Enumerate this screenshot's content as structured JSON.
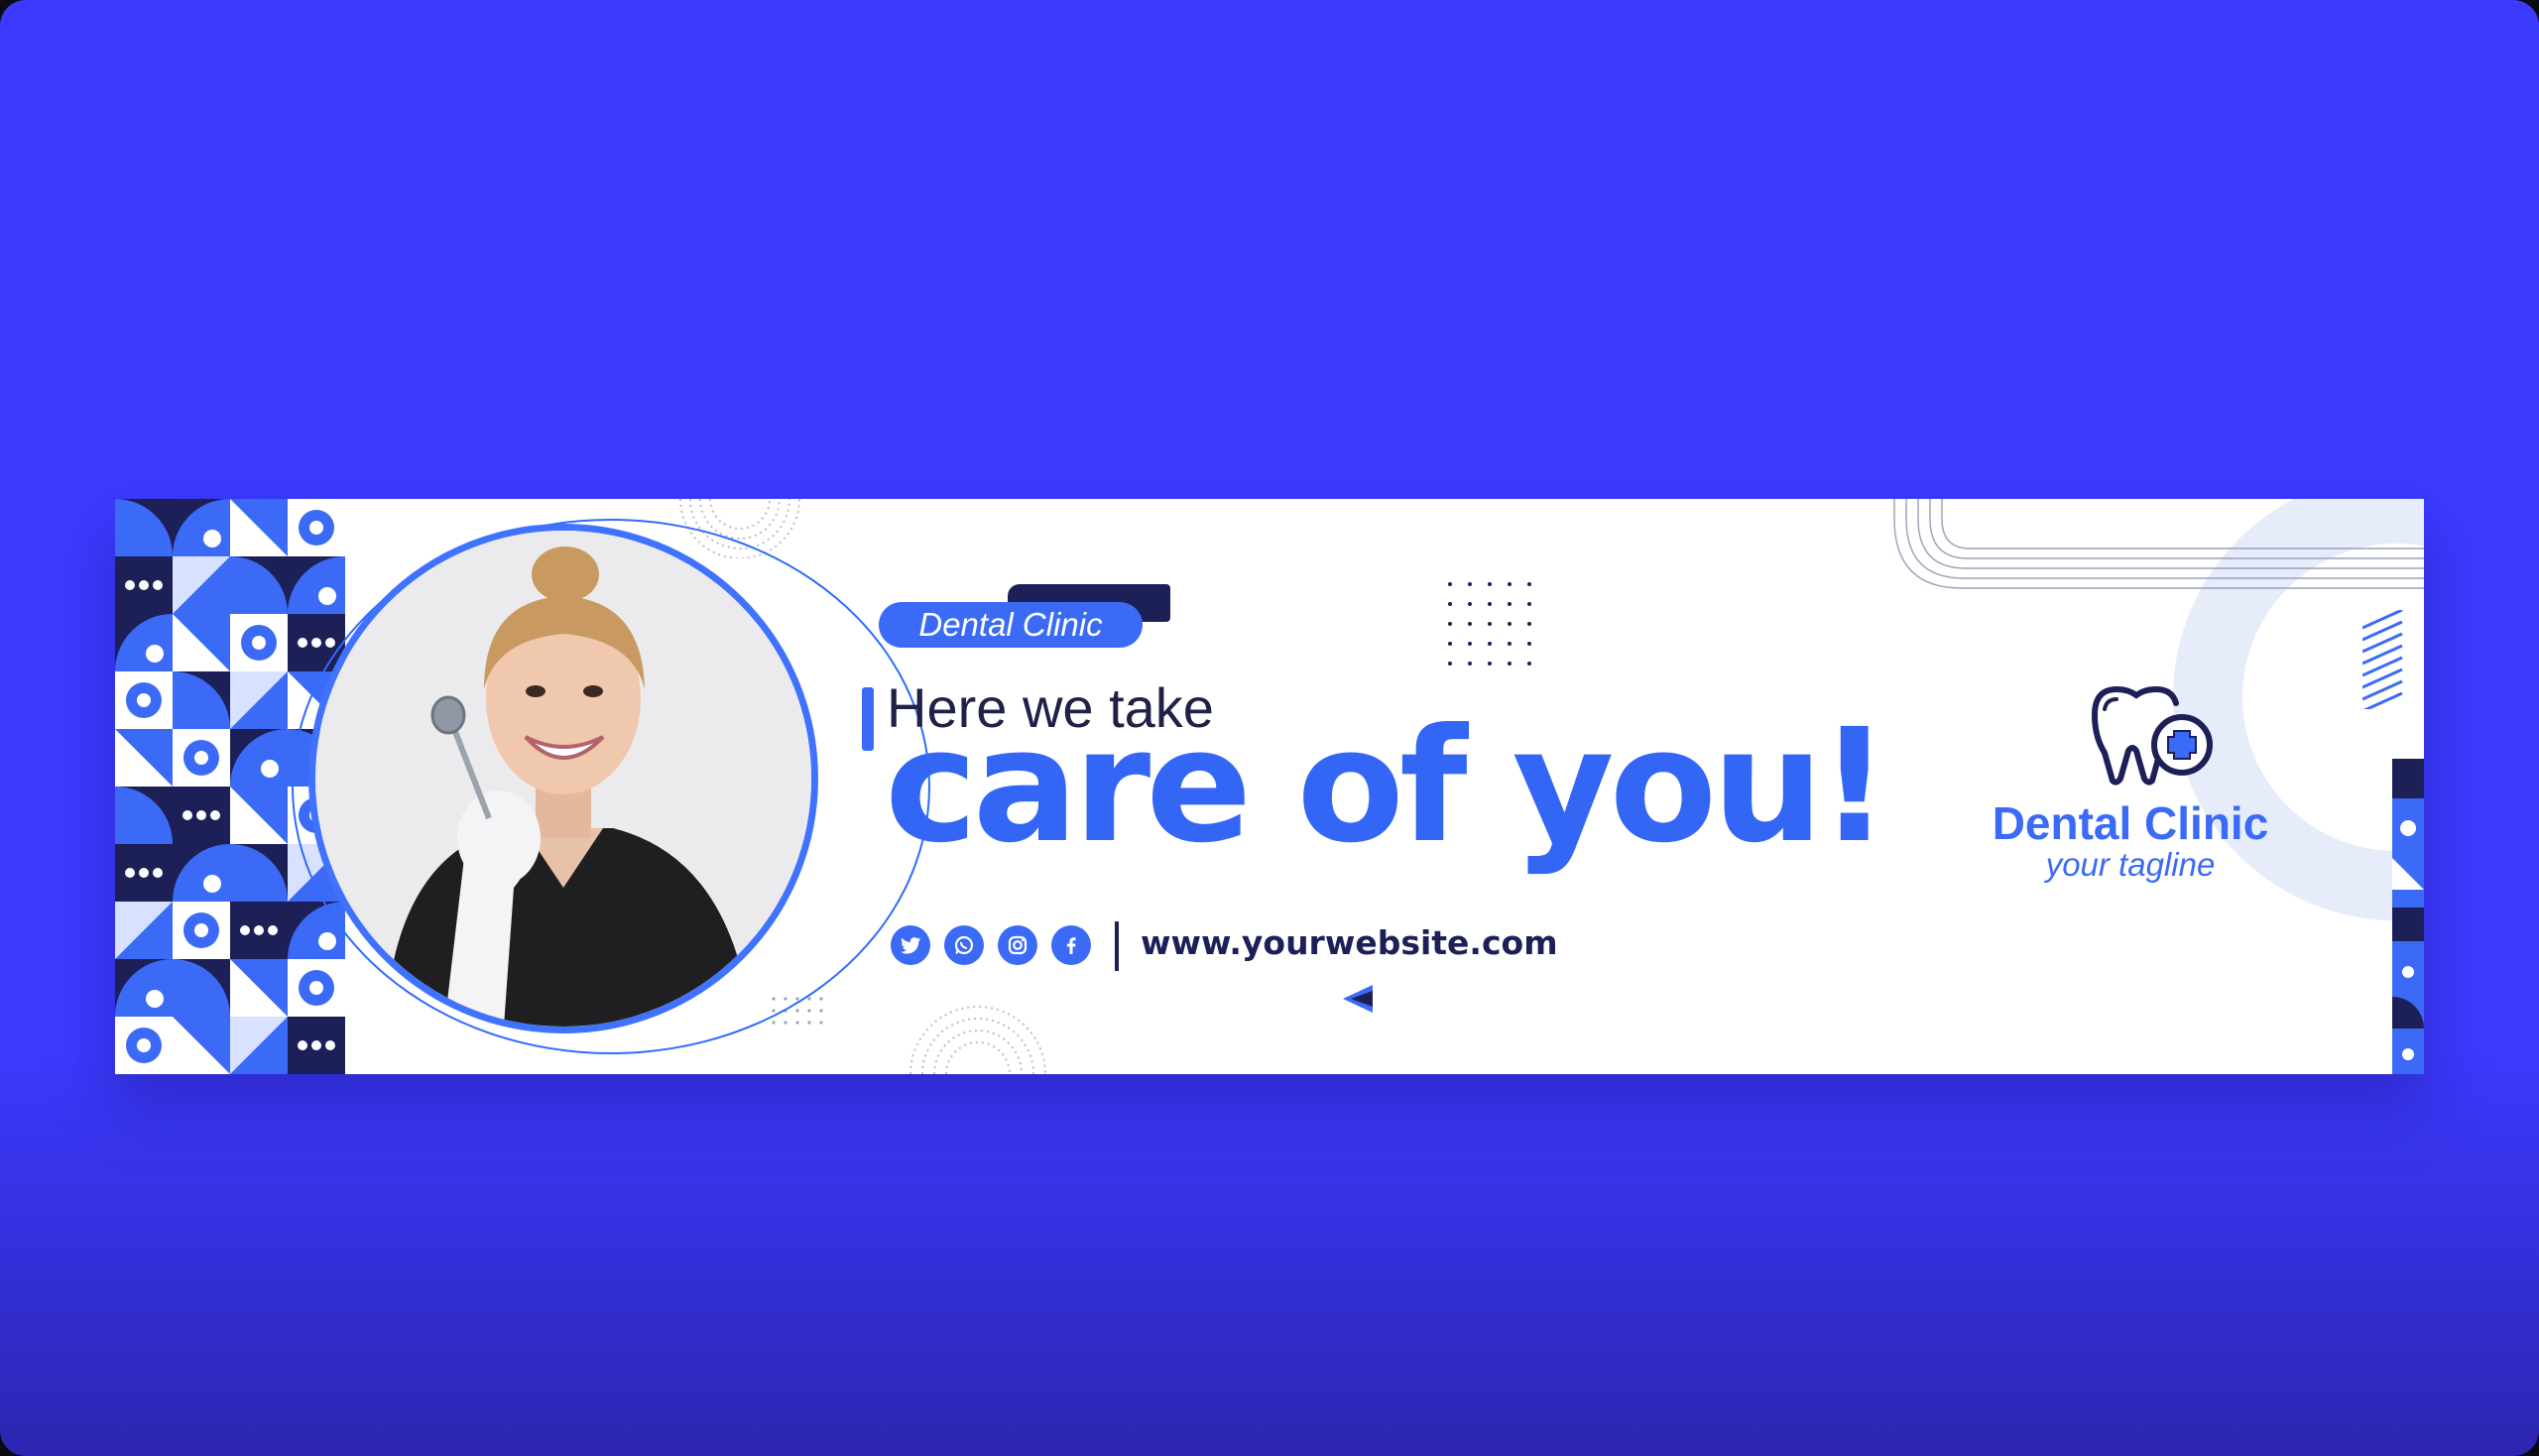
{
  "banner": {
    "badge_label": "Dental Clinic",
    "subheading": "Here we take",
    "headline": "care of you!",
    "website": "www.yourwebsite.com",
    "brand": {
      "name": "Dental Clinic",
      "tagline": "your tagline",
      "logo_icon": "tooth-plus-icon"
    },
    "socials": [
      {
        "icon": "twitter-icon"
      },
      {
        "icon": "whatsapp-icon"
      },
      {
        "icon": "instagram-icon"
      },
      {
        "icon": "facebook-icon"
      }
    ],
    "photo": "smiling dentist holding a dental mirror"
  },
  "colors": {
    "background": "#3c3aff",
    "primary": "#3b6bf6",
    "navy": "#1d1f57",
    "light": "#ffffff",
    "pale_blue": "#e6ecfa"
  }
}
